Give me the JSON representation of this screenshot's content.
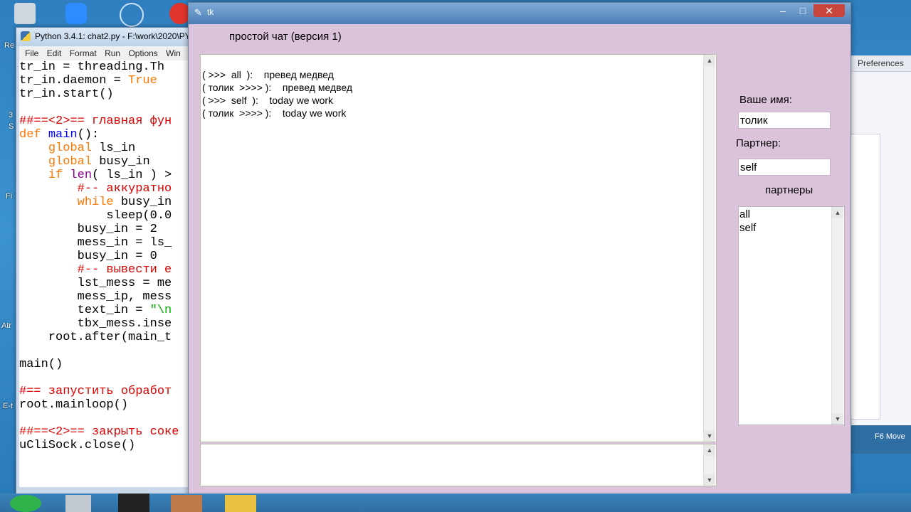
{
  "desktop": {
    "left_labels": [
      "Re",
      "3",
      "S",
      "Fi",
      "Atr",
      "E-t"
    ]
  },
  "idle": {
    "title": "Python 3.4.1: chat2.py - F:\\work\\2020\\PY",
    "menu": [
      "File",
      "Edit",
      "Format",
      "Run",
      "Options",
      "Win"
    ],
    "code_lines": [
      [
        {
          "t": "tr_in = threading.Th",
          "c": ""
        }
      ],
      [
        {
          "t": "tr_in.daemon = ",
          "c": ""
        },
        {
          "t": "True",
          "c": "kw"
        }
      ],
      [
        {
          "t": "tr_in.start()",
          "c": ""
        }
      ],
      [
        {
          "t": "",
          "c": ""
        }
      ],
      [
        {
          "t": "##==<2>== главная фун",
          "c": "cm"
        }
      ],
      [
        {
          "t": "def ",
          "c": "kw"
        },
        {
          "t": "main",
          "c": "df"
        },
        {
          "t": "():",
          "c": ""
        }
      ],
      [
        {
          "t": "    ",
          "c": ""
        },
        {
          "t": "global",
          "c": "kw"
        },
        {
          "t": " ls_in",
          "c": ""
        }
      ],
      [
        {
          "t": "    ",
          "c": ""
        },
        {
          "t": "global",
          "c": "kw"
        },
        {
          "t": " busy_in",
          "c": ""
        }
      ],
      [
        {
          "t": "    ",
          "c": ""
        },
        {
          "t": "if ",
          "c": "kw"
        },
        {
          "t": "len",
          "c": "bi"
        },
        {
          "t": "( ls_in ) >",
          "c": ""
        }
      ],
      [
        {
          "t": "        ",
          "c": ""
        },
        {
          "t": "#-- аккуратно",
          "c": "cm"
        }
      ],
      [
        {
          "t": "        ",
          "c": ""
        },
        {
          "t": "while",
          "c": "kw"
        },
        {
          "t": " busy_in",
          "c": ""
        }
      ],
      [
        {
          "t": "            sleep(0.0",
          "c": ""
        }
      ],
      [
        {
          "t": "        busy_in = 2",
          "c": ""
        }
      ],
      [
        {
          "t": "        mess_in = ls_",
          "c": ""
        }
      ],
      [
        {
          "t": "        busy_in = 0",
          "c": ""
        }
      ],
      [
        {
          "t": "        ",
          "c": ""
        },
        {
          "t": "#-- вывести е",
          "c": "cm"
        }
      ],
      [
        {
          "t": "        lst_mess = me",
          "c": ""
        }
      ],
      [
        {
          "t": "        mess_ip, mess",
          "c": ""
        }
      ],
      [
        {
          "t": "        text_in = ",
          "c": ""
        },
        {
          "t": "\"\\n",
          "c": "st"
        }
      ],
      [
        {
          "t": "        tbx_mess.inse",
          "c": ""
        }
      ],
      [
        {
          "t": "    root.after(main_t",
          "c": ""
        }
      ],
      [
        {
          "t": "",
          "c": ""
        }
      ],
      [
        {
          "t": "main()",
          "c": ""
        }
      ],
      [
        {
          "t": "",
          "c": ""
        }
      ],
      [
        {
          "t": "#== запустить обработ",
          "c": "cm"
        }
      ],
      [
        {
          "t": "root.mainloop()",
          "c": ""
        }
      ],
      [
        {
          "t": "",
          "c": ""
        }
      ],
      [
        {
          "t": "##==<2>== закрыть соке",
          "c": "cm"
        }
      ],
      [
        {
          "t": "uCliSock.close()",
          "c": ""
        }
      ]
    ]
  },
  "bgapp": {
    "preferences": "Preferences",
    "f6_move": "F6 Move"
  },
  "tk": {
    "window_title": "tk",
    "minimize": "–",
    "maximize": "□",
    "close": "✕",
    "heading": "простой чат (версия 1)",
    "messages": [
      "( >>>  all  ):    превед медвед",
      "( толик  >>>> ):    превед медвед",
      "( >>>  self  ):    today we work",
      "( толик  >>>> ):    today we work"
    ],
    "name_label": "Ваше имя:",
    "name_value": "толик",
    "partner_label": "Партнер:",
    "partner_value": "self",
    "partners_label": "партнеры",
    "partners": [
      "all",
      "self"
    ]
  }
}
